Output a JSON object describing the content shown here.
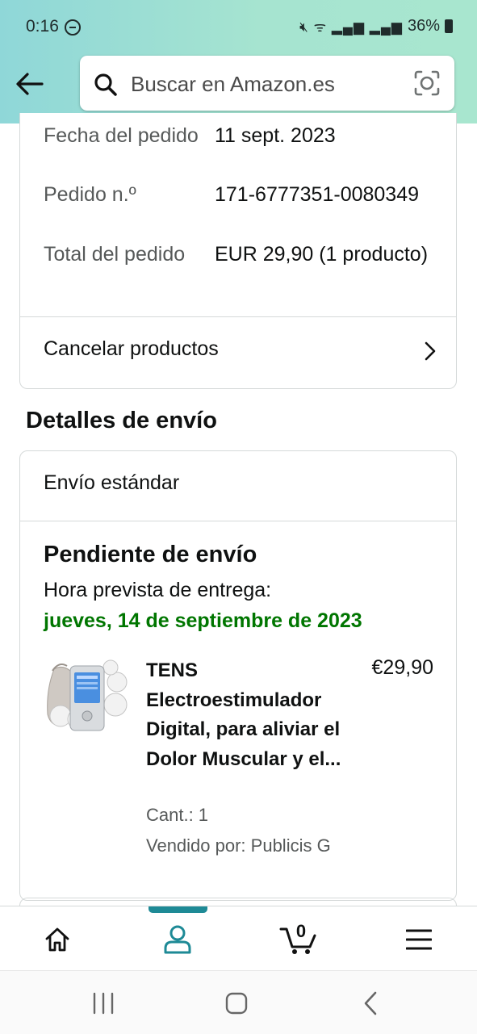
{
  "status_bar": {
    "time": "0:16",
    "battery": "36%"
  },
  "search": {
    "placeholder": "Buscar en Amazon.es"
  },
  "order": {
    "rows": [
      {
        "label": "Fecha del pedido",
        "value": "11 sept. 2023"
      },
      {
        "label": "Pedido n.º",
        "value": "171-6777351-0080349"
      },
      {
        "label": "Total del pedido",
        "value": "EUR 29,90 (1 producto)"
      }
    ],
    "cancel_label": "Cancelar productos"
  },
  "shipping": {
    "section_title": "Detalles de envío",
    "method": "Envío estándar",
    "status_title": "Pendiente de envío",
    "delivery_label": "Hora prevista de entrega:",
    "delivery_date": "jueves, 14 de septiembre de 2023",
    "product": {
      "title": "TENS Electroestimulador Digital, para aliviar el Dolor Muscular y el...",
      "price": "€29,90",
      "quantity": "Cant.: 1",
      "seller": "Vendido por: Publicis G"
    }
  },
  "bottom_nav": {
    "items": [
      "home-icon",
      "account-icon",
      "cart-icon",
      "menu-icon"
    ],
    "active": "account-icon",
    "cart_count": "0"
  },
  "colors": {
    "header_gradient_start": "#8fd7d8",
    "header_gradient_end": "#a8e6cf",
    "delivery_green": "#007600",
    "active_teal": "#1e8a96"
  }
}
